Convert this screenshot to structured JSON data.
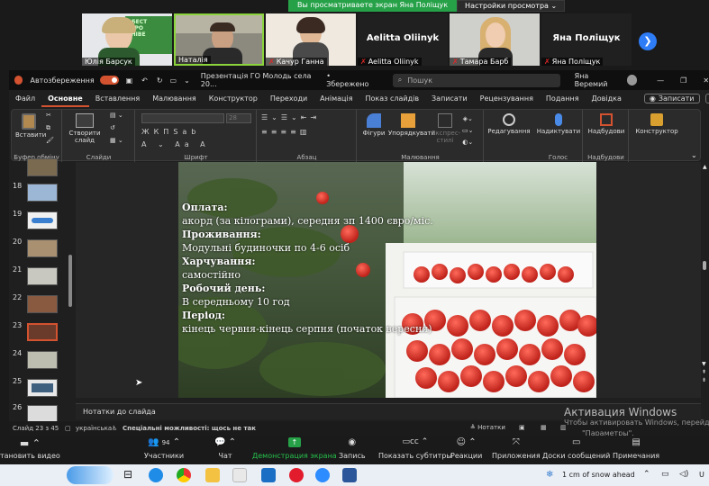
{
  "zoom": {
    "share_banner": "Вы просматриваете экран Яна Поліщук",
    "view_settings": "Настройки просмотра",
    "participants": [
      {
        "name": "Юлія Барсук",
        "muted": false,
        "video": true
      },
      {
        "name": "Наталія",
        "muted": false,
        "video": true
      },
      {
        "name": "Качур Ганна",
        "muted": true,
        "video": true
      },
      {
        "name": "Aelitta Oliinyk",
        "muted": true,
        "video": false,
        "display": "Aelitta Oliinyk"
      },
      {
        "name": "Тамара Барб",
        "muted": true,
        "video": true
      },
      {
        "name": "Яна Поліщук",
        "muted": true,
        "video": false,
        "display": "Яна Поліщук"
      }
    ],
    "toolbar": {
      "stop_video": "тановить видео",
      "participants": "Участники",
      "participants_count": "94",
      "chat": "Чат",
      "share": "Демонстрация экрана",
      "record": "Запись",
      "captions": "Показать субтитры",
      "reactions": "Реакции",
      "apps": "Приложения",
      "whiteboards": "Доски сообщений",
      "notes": "Примечания"
    }
  },
  "ppt": {
    "autosave": "Автозбереження",
    "file_title": "Презентація ГО Молодь села 20...",
    "saved": "• Збережено",
    "search_placeholder": "Пошук",
    "user": "Яна Веремий",
    "tabs": [
      "Файл",
      "Основне",
      "Вставлення",
      "Малювання",
      "Конструктор",
      "Переходи",
      "Анімація",
      "Показ слайдів",
      "Записати",
      "Рецензування",
      "Подання",
      "Довідка"
    ],
    "active_tab": "Основне",
    "record_btn": "Записати",
    "ribbon": {
      "paste": "Вставити",
      "clipboard": "Буфер обміну",
      "new_slide": "Створити слайд",
      "slides": "Слайди",
      "font": "Шрифт",
      "font_size": "28",
      "paragraph": "Абзац",
      "shapes": "Фігури",
      "arrange": "Упорядкувати",
      "quick_styles": "Експрес-стилі",
      "drawing": "Малювання",
      "editing": "Редагування",
      "dictate": "Надиктувати",
      "voice": "Голос",
      "addins": "Надбудови",
      "addins_group": "Надбудови",
      "designer": "Конструктор"
    },
    "thumbnails": [
      {
        "num": "18",
        "star": false
      },
      {
        "num": "19",
        "star": false
      },
      {
        "num": "20",
        "star": true
      },
      {
        "num": "21",
        "star": true
      },
      {
        "num": "22",
        "star": true
      },
      {
        "num": "23",
        "star": true,
        "selected": true
      },
      {
        "num": "24",
        "star": true
      },
      {
        "num": "25",
        "star": true
      },
      {
        "num": "26",
        "star": true
      }
    ],
    "slide": {
      "lines": [
        {
          "text": "Оплата:",
          "bold": true
        },
        {
          "text": "акорд (за кілограми), середня зп 1400 євро/міс.",
          "bold": false
        },
        {
          "text": "Проживання:",
          "bold": true
        },
        {
          "text": "Модульні будиночки по 4-6 осіб",
          "bold": false
        },
        {
          "text": "Харчування:",
          "bold": true
        },
        {
          "text": "самостійно",
          "bold": false
        },
        {
          "text": "Робочий день:",
          "bold": true
        },
        {
          "text": "В середньому 10 год",
          "bold": false
        },
        {
          "text": "Період:",
          "bold": true
        },
        {
          "text": "кінець червня-кінець серпня (початок вересня)",
          "bold": false
        }
      ]
    },
    "notes_placeholder": "Нотатки до слайда",
    "status": {
      "slide_of": "Слайд 23 з 45",
      "language": "українська",
      "accessibility": "Спеціальні можливості: щось не так",
      "notes_btn": "Нотатки"
    }
  },
  "activation": {
    "title": "Активация Windows",
    "sub1": "Чтобы активировать Windows, перейдите",
    "sub2": "\"Параметры\"."
  },
  "taskbar": {
    "weather": "1 cm of snow ahead",
    "lang": "U"
  }
}
